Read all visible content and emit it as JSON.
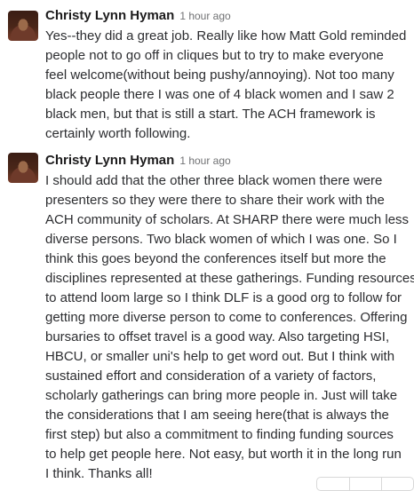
{
  "messages": [
    {
      "author": "Christy Lynn Hyman",
      "time": "1 hour ago",
      "lines": [
        "Yes--they did a great job. Really like how Matt Gold reminded",
        "people not to go off in cliques but to try to make everyone",
        "feel welcome(without being pushy/annoying). Not too many",
        "black people there I was one of 4 black women and I saw 2",
        "black men, but that is still a start. The ACH framework is",
        "certainly worth following."
      ]
    },
    {
      "author": "Christy Lynn Hyman",
      "time": "1 hour ago",
      "lines": [
        "I should add that the other three black women there were",
        "presenters so they were there to share their work with the",
        "ACH community of scholars. At SHARP there were much less",
        "diverse persons. Two black women of which I was one. So I",
        "think this goes beyond the conferences itself but more the",
        "disciplines represented at these gatherings. Funding resources",
        "to attend loom large so I think DLF is a good org to follow for",
        "getting more diverse person to come to conferences. Offering",
        "bursaries to offset travel is a good way. Also targeting HSI,",
        "HBCU, or smaller uni's help to get word out. But I think with",
        "sustained effort and consideration of a variety of factors,",
        "scholarly gatherings can bring more people in. Just will take",
        "the considerations that I am seeing here(that is always the",
        "first step) but also a commitment to finding funding sources",
        "to help get people here. Not easy, but worth it in the long run",
        "I think. Thanks all!"
      ]
    }
  ]
}
